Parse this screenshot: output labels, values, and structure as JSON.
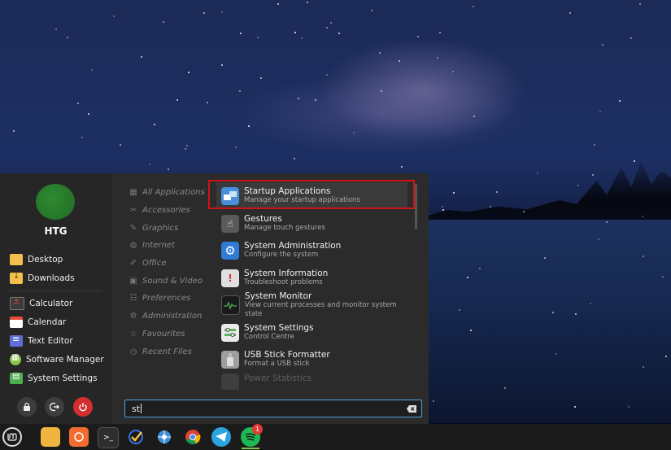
{
  "user": {
    "name": "HTG"
  },
  "places": [
    {
      "label": "Desktop",
      "icon": "folder-icon"
    },
    {
      "label": "Downloads",
      "icon": "folder-download-icon"
    }
  ],
  "favorites": [
    {
      "label": "Calculator",
      "icon": "calculator-icon"
    },
    {
      "label": "Calendar",
      "icon": "calendar-icon"
    },
    {
      "label": "Text Editor",
      "icon": "text-editor-icon"
    },
    {
      "label": "Software Manager",
      "icon": "software-manager-icon"
    },
    {
      "label": "System Settings",
      "icon": "system-settings-icon"
    }
  ],
  "categories": [
    {
      "label": "All Applications",
      "icon": "grid-icon"
    },
    {
      "label": "Accessories",
      "icon": "scissors-icon"
    },
    {
      "label": "Graphics",
      "icon": "paint-icon"
    },
    {
      "label": "Internet",
      "icon": "globe-icon"
    },
    {
      "label": "Office",
      "icon": "office-icon"
    },
    {
      "label": "Sound & Video",
      "icon": "media-icon"
    },
    {
      "label": "Preferences",
      "icon": "sliders-icon"
    },
    {
      "label": "Administration",
      "icon": "gear-icon"
    },
    {
      "label": "Favourites",
      "icon": "star-icon"
    },
    {
      "label": "Recent Files",
      "icon": "clock-icon"
    }
  ],
  "apps": [
    {
      "name": "Startup Applications",
      "desc": "Manage your startup applications",
      "icon": "startup-applications-icon",
      "color": "#4a90d9"
    },
    {
      "name": "Gestures",
      "desc": "Manage touch gestures",
      "icon": "gestures-icon",
      "color": "#5a5a5a"
    },
    {
      "name": "System Administration",
      "desc": "Configure the system",
      "icon": "system-administration-icon",
      "color": "#2f7bd6"
    },
    {
      "name": "System Information",
      "desc": "Troubleshoot problems",
      "icon": "system-information-icon",
      "color": "#e0e0e0"
    },
    {
      "name": "System Monitor",
      "desc": "View current processes and monitor system state",
      "icon": "system-monitor-icon",
      "color": "#1a1a1a"
    },
    {
      "name": "System Settings",
      "desc": "Control Centre",
      "icon": "system-settings-icon",
      "color": "#5cb85c"
    },
    {
      "name": "USB Stick Formatter",
      "desc": "Format a USB stick",
      "icon": "usb-formatter-icon",
      "color": "#9e9e9e"
    },
    {
      "name": "Power Statistics",
      "desc": "",
      "icon": "power-statistics-icon",
      "color": "#777777"
    }
  ],
  "search": {
    "value": "st"
  },
  "taskbar": {
    "badge_count": "1",
    "apps": [
      "mint-menu-icon",
      "files-icon",
      "firefox-icon",
      "terminal-icon",
      "tasks-icon",
      "app-icon",
      "chrome-icon",
      "telegram-icon",
      "spotify-icon"
    ]
  },
  "colors": {
    "accent": "#4aa3e8",
    "highlight": "#d0121b",
    "power": "#d32f2f"
  }
}
